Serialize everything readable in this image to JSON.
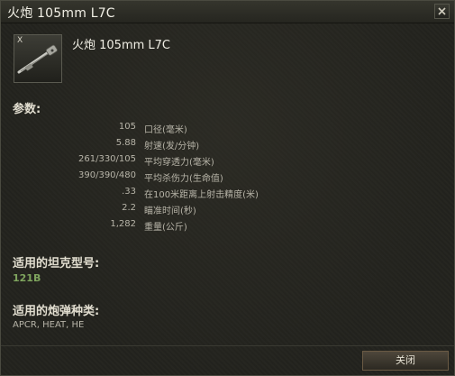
{
  "window": {
    "title": "火炮 105mm L7C"
  },
  "module": {
    "tier": "X",
    "name": "火炮 105mm L7C",
    "icon": "gun-icon"
  },
  "sections": {
    "params_label": "参数:",
    "tanks_label": "适用的坦克型号:",
    "ammo_label": "适用的炮弹种类:"
  },
  "params": [
    {
      "value": "105",
      "name": "口径(毫米)"
    },
    {
      "value": "5.88",
      "name": "射速(发/分钟)"
    },
    {
      "value": "261/330/105",
      "name": "平均穿透力(毫米)"
    },
    {
      "value": "390/390/480",
      "name": "平均杀伤力(生命值)"
    },
    {
      "value": ".33",
      "name": "在100米距离上射击精度(米)"
    },
    {
      "value": "2.2",
      "name": "瞄准时间(秒)"
    },
    {
      "value": "1,282",
      "name": "重量(公斤)"
    }
  ],
  "tanks": {
    "value": "121B"
  },
  "ammo": {
    "value": "APCR, HEAT, HE"
  },
  "footer": {
    "close_label": "关闭"
  },
  "colors": {
    "tank_highlight": "#7fa55e",
    "background": "#23231e"
  }
}
